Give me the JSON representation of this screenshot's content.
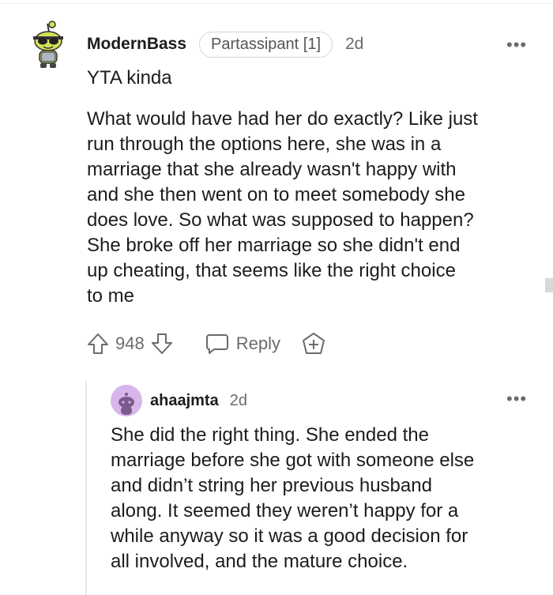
{
  "comment": {
    "username": "ModernBass",
    "flair": "Partassipant [1]",
    "age": "2d",
    "verdict": "YTA kinda",
    "paragraph_lines": [
      "What would have had her do exactly? Like just",
      "run through the options here, she was in a",
      "marriage that she already wasn't happy with",
      "and she then went on to meet somebody she",
      "does love. So what was supposed to happen?",
      "She broke off her marriage so she didn't end",
      "up cheating, that seems like the right choice",
      "to me"
    ],
    "votes": "948",
    "reply_label": "Reply",
    "more_label": "•••"
  },
  "reply": {
    "username": "ahaajmta",
    "age": "2d",
    "more_label": "•••",
    "lines": [
      "She did the right thing. She ended the",
      "marriage before she got with someone else",
      "and didn’t string her previous husband",
      "along. It seemed they weren’t happy for a",
      "while anyway so it was a good decision for",
      "all involved, and the mature choice."
    ]
  },
  "icons": {
    "avatar_main": "snoo-avatar-sunglasses",
    "avatar_reply": "default-snoo-avatar",
    "upvote": "upvote-arrow-icon",
    "downvote": "downvote-arrow-icon",
    "reply": "chat-bubble-icon",
    "award": "plus-award-icon",
    "more": "more-dots-icon"
  },
  "colors": {
    "avatar_reply_bg": "#d7b6ec",
    "avatar_main_body": "#d4e157",
    "text": "#1c1c1c",
    "muted": "#6b6b6b"
  }
}
